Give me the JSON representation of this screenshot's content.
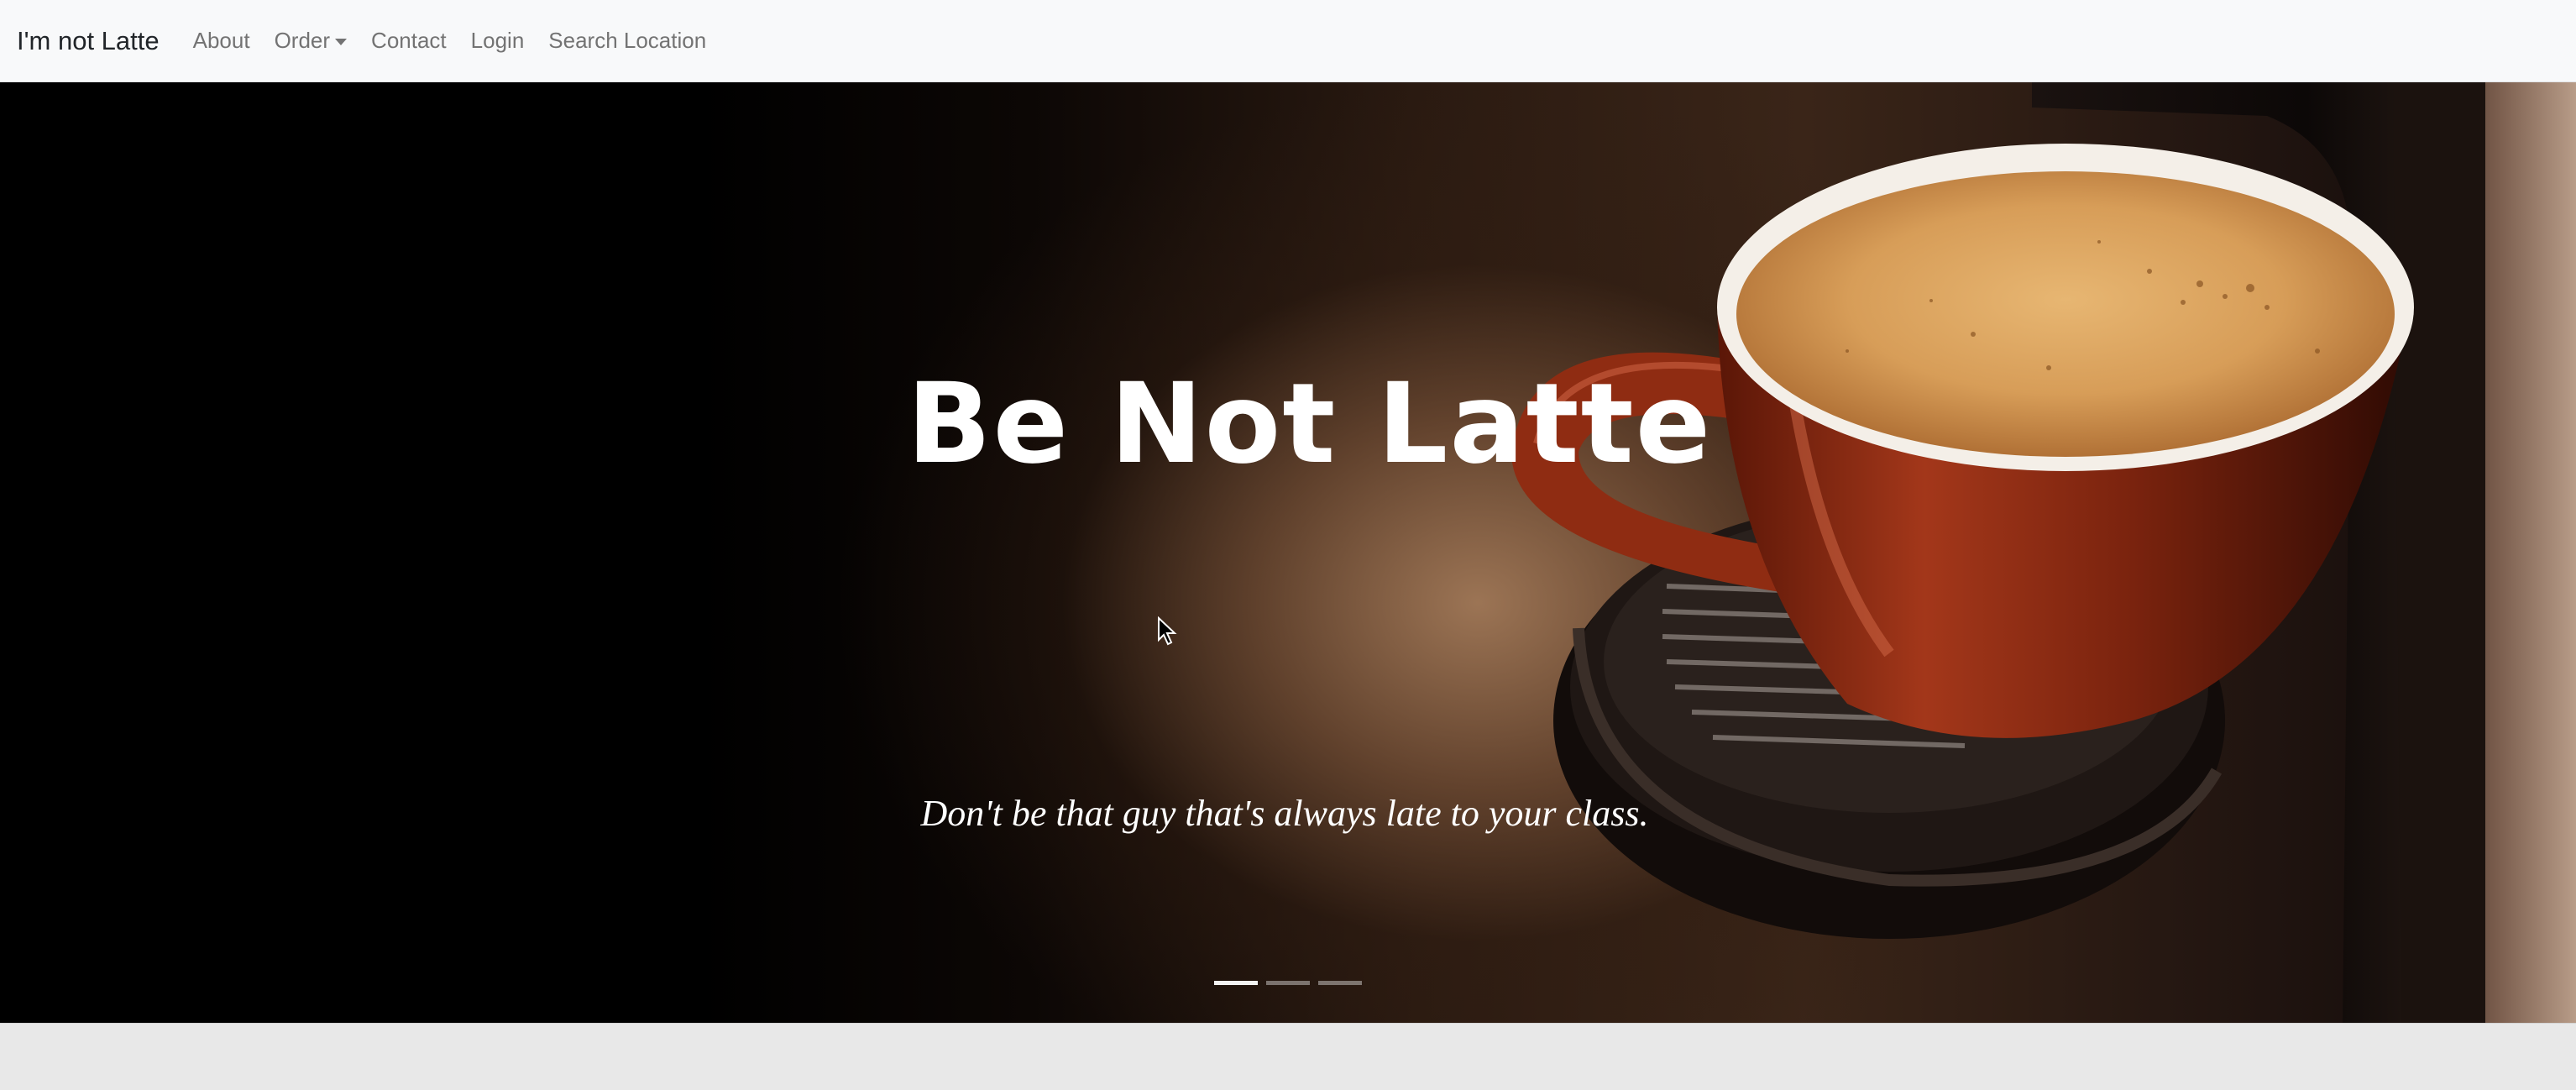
{
  "navbar": {
    "brand": "I'm not Latte",
    "links": [
      {
        "label": "About"
      },
      {
        "label": "Order",
        "dropdown": true
      },
      {
        "label": "Contact"
      },
      {
        "label": "Login"
      },
      {
        "label": "Search Location"
      }
    ]
  },
  "hero": {
    "title": "Be Not Latte",
    "caption": "Don't be that guy that's always late to your class.",
    "carousel": {
      "slide_count": 3,
      "active_index": 0
    }
  },
  "colors": {
    "navbar_bg": "#f8f9fa",
    "link": "#737373",
    "brand": "#212529",
    "cup_body": "#8a2a12",
    "foam": "#d9a05e"
  },
  "icons": {
    "cursor": "mouse-pointer-icon",
    "dropdown": "caret-down-icon"
  }
}
